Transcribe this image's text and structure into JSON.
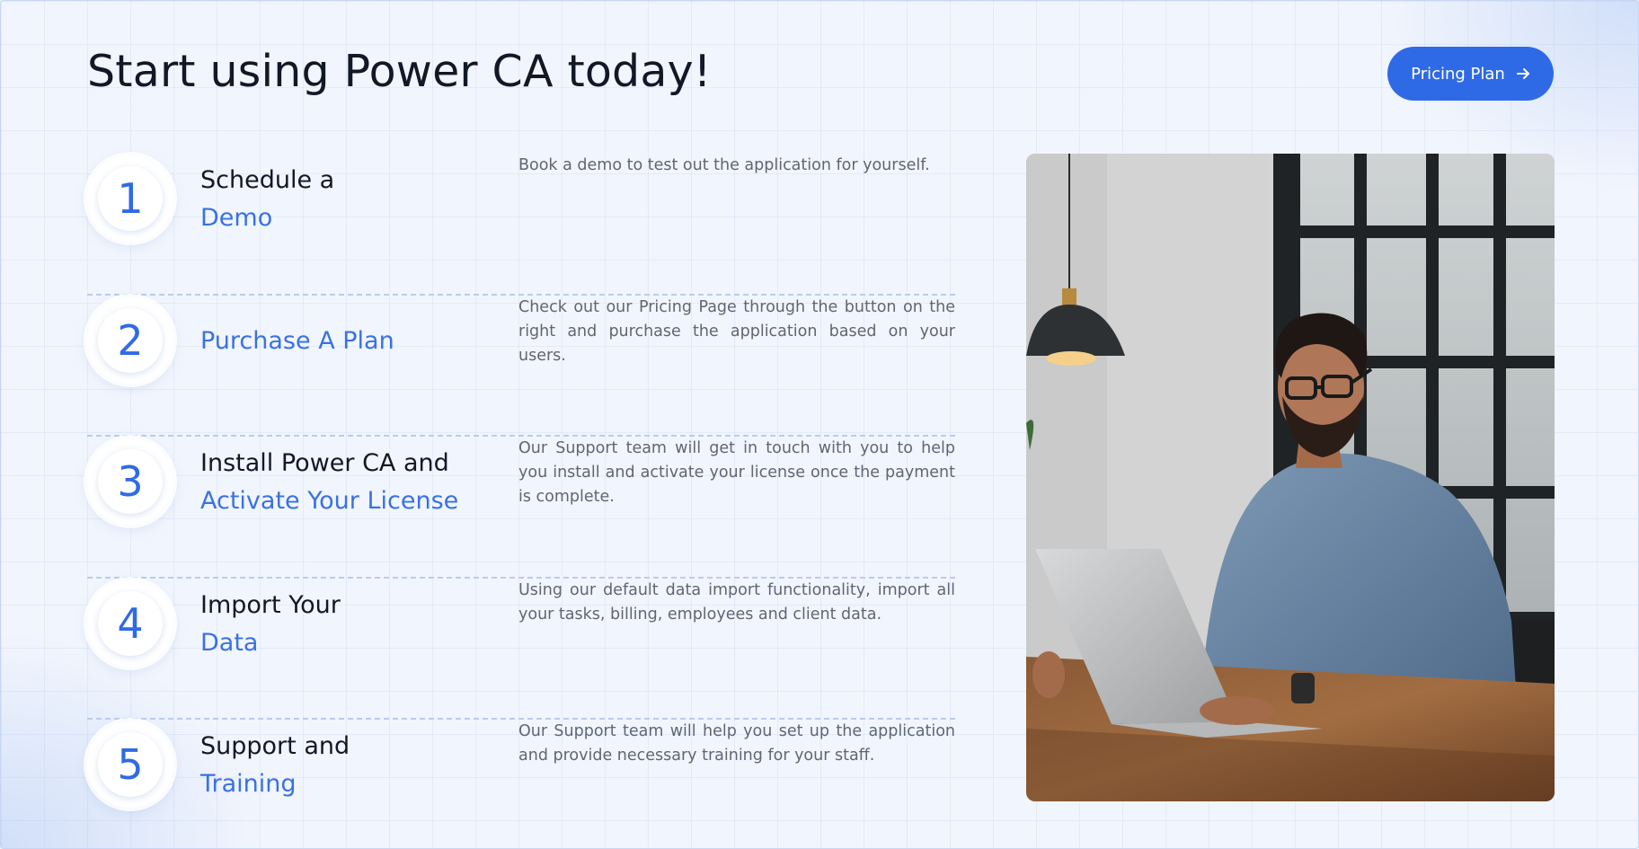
{
  "header": {
    "title": "Start using Power CA today!",
    "pricing_button_label": "Pricing Plan"
  },
  "steps": [
    {
      "number": "1",
      "title_dark": "Schedule a",
      "title_blue": "Demo",
      "description": "Book a demo to test out the application for yourself."
    },
    {
      "number": "2",
      "title_dark": "",
      "title_blue": "Purchase A Plan",
      "description": "Check out our Pricing Page through the button on the right and purchase the application based on your users."
    },
    {
      "number": "3",
      "title_dark": "Install Power CA and",
      "title_blue": "Activate Your License",
      "description": "Our Support team will get in touch with you to help you install and activate your license once the payment is complete."
    },
    {
      "number": "4",
      "title_dark": "Import Your",
      "title_blue": "Data",
      "description": "Using our default data import functionality, import all your tasks, billing, employees and client data."
    },
    {
      "number": "5",
      "title_dark": "Support and",
      "title_blue": "Training",
      "description": "Our Support team will help you set up the application and provide necessary training for your staff."
    }
  ],
  "colors": {
    "accent": "#2f6ae6",
    "accent_text": "#3a71e4",
    "heading": "#111827",
    "body_text": "#5f6674",
    "background": "#f1f5fd"
  },
  "icons": {
    "pricing_button": "arrow-right-icon"
  }
}
